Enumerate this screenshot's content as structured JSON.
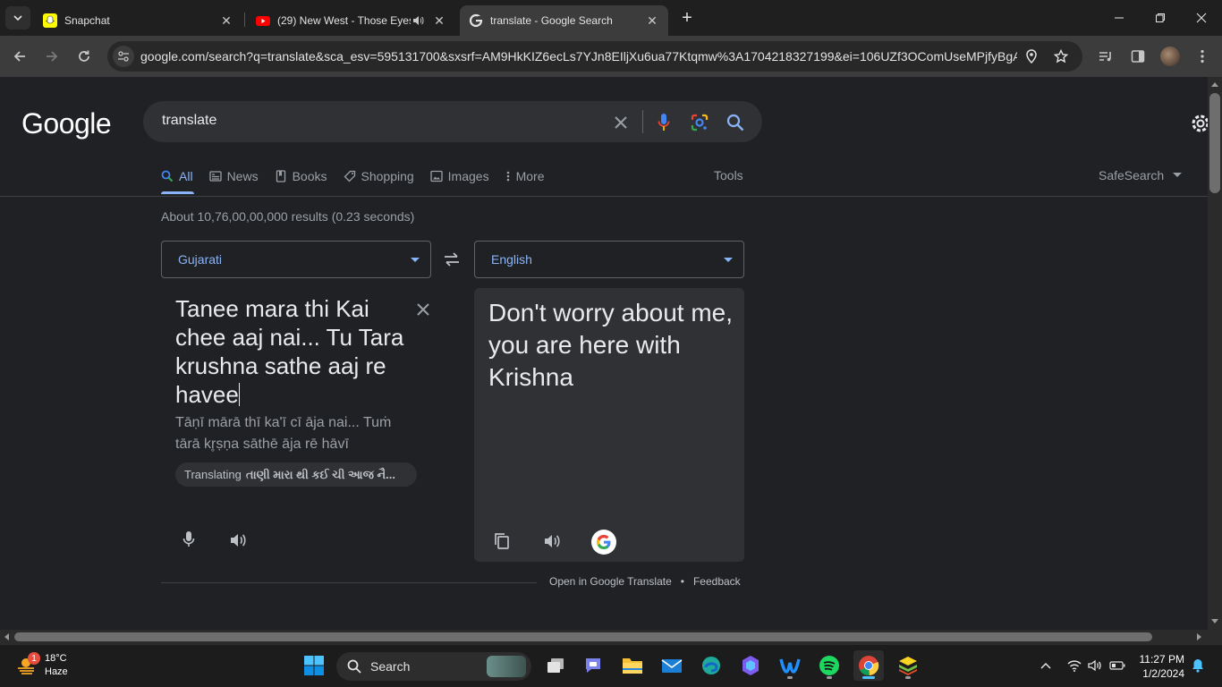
{
  "browser": {
    "tabs": [
      {
        "title": "Snapchat",
        "favicon": "snapchat-icon",
        "active": false
      },
      {
        "title": "(29) New West - Those Eyes",
        "favicon": "youtube-icon",
        "active": false,
        "playing_audio": true
      },
      {
        "title": "translate - Google Search",
        "favicon": "google-icon",
        "active": true
      }
    ],
    "url": "google.com/search?q=translate&sca_esv=595131700&sxsrf=AM9HkKIZ6ecLs7YJn8EIljXu6ua77Ktqmw%3A1704218327199&ei=106UZf3OComUseMPjfyBgA8..."
  },
  "google": {
    "logo": "Google",
    "query": "translate",
    "nav_tabs": [
      {
        "label": "All",
        "icon": "search-icon",
        "active": true
      },
      {
        "label": "News",
        "icon": "news-icon"
      },
      {
        "label": "Books",
        "icon": "book-icon"
      },
      {
        "label": "Shopping",
        "icon": "tag-icon"
      },
      {
        "label": "Images",
        "icon": "image-icon"
      },
      {
        "label": "More",
        "icon": "more-vert-icon"
      }
    ],
    "tools": "Tools",
    "safesearch": "SafeSearch",
    "result_stats": "About 10,76,00,00,000 results (0.23 seconds)"
  },
  "translate": {
    "source_lang": "Gujarati",
    "target_lang": "English",
    "source_text": "Tanee mara thi Kai chee aaj nai... Tu Tara krushna sathe aaj re havee",
    "transliteration": "Tāṇī mārā thī ka'ī cī āja nai... Tuṁ tārā kr̥ṣṇa sāthē āja rē hāvī",
    "translating_label": "Translating",
    "translating_native": "તાણી મારા થી કઈ ચી આજ નૈ...",
    "target_text": "Don't worry about me, you are here with Krishna",
    "open_link": "Open in Google Translate",
    "separator": "•",
    "feedback": "Feedback"
  },
  "taskbar": {
    "weather_temp": "18°C",
    "weather_desc": "Haze",
    "weather_badge": "1",
    "search_label": "Search",
    "time": "11:27 PM",
    "date": "1/2/2024"
  },
  "colors": {
    "accent_blue": "#8ab4f8",
    "page_bg": "#202124",
    "panel_bg": "#303134"
  }
}
